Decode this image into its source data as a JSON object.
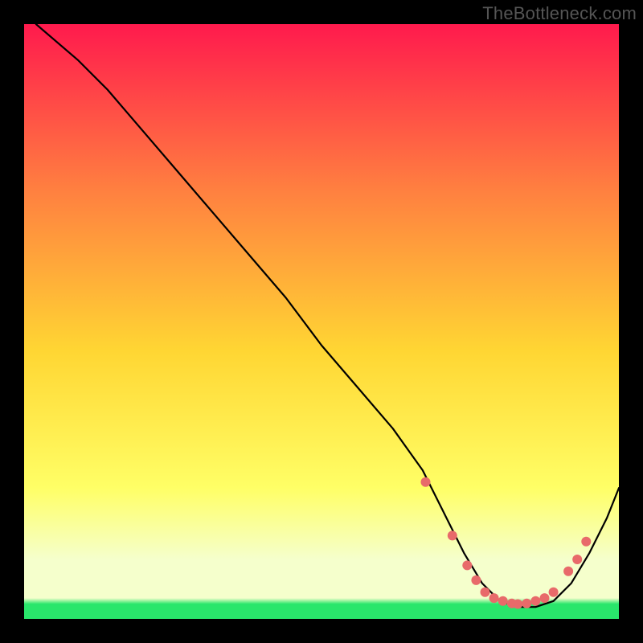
{
  "watermark": "TheBottleneck.com",
  "chart_data": {
    "type": "line",
    "title": "",
    "xlabel": "",
    "ylabel": "",
    "xlim": [
      0,
      100
    ],
    "ylim": [
      0,
      100
    ],
    "background_gradient": {
      "top": "#ff1a4d",
      "mid_upper": "#ff8040",
      "mid": "#ffd633",
      "mid_lower": "#ffff66",
      "lower_band": "#f5ffcc",
      "bottom": "#29e66b"
    },
    "curve": {
      "x": [
        2,
        9,
        14,
        20,
        26,
        32,
        38,
        44,
        50,
        56,
        62,
        67,
        71,
        74,
        77,
        80,
        83,
        86,
        89,
        92,
        95,
        98,
        100
      ],
      "y": [
        100,
        94,
        89,
        82,
        75,
        68,
        61,
        54,
        46,
        39,
        32,
        25,
        17,
        11,
        6,
        3,
        2,
        2,
        3,
        6,
        11,
        17,
        22
      ]
    },
    "markers": {
      "color": "#e86a6a",
      "x": [
        67.5,
        72,
        74.5,
        76,
        77.5,
        79,
        80.5,
        82,
        83,
        84.5,
        86,
        87.5,
        89,
        91.5,
        93,
        94.5
      ],
      "y": [
        23,
        14,
        9,
        6.5,
        4.5,
        3.5,
        3,
        2.6,
        2.5,
        2.6,
        3,
        3.5,
        4.5,
        8,
        10,
        13
      ]
    }
  }
}
